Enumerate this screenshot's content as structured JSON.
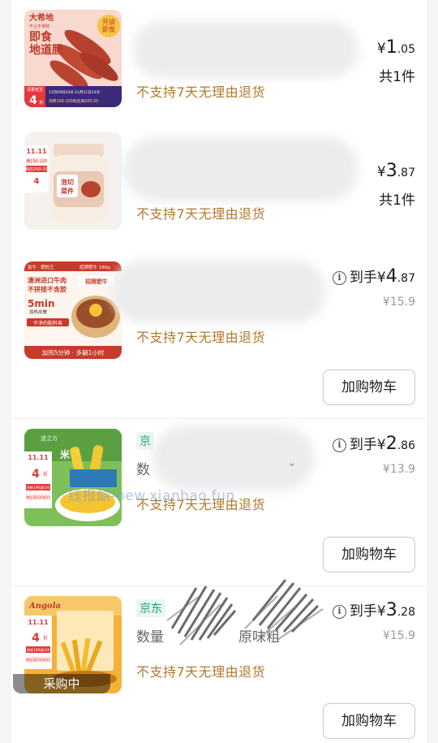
{
  "items": [
    {
      "price_symbol": "¥",
      "price_int": "1",
      "price_dec": ".05",
      "quantity": "共1件",
      "policy": "不支持7天无理由退货",
      "thumb_text": {
        "brand": "大希地",
        "brand_sub": "不止牛排鲜",
        "title_line1": "即食",
        "title_line2": "地道肠",
        "badge_line1": "开袋",
        "badge_line2": "即食",
        "promo_tag": "清香低至",
        "promo_num": "4",
        "promo_unit": "折",
        "date": "11月09日20点-11月11日24点",
        "deal": "领券199-100跨店满200-20"
      }
    },
    {
      "price_symbol": "¥",
      "price_int": "3",
      "price_dec": ".87",
      "quantity": "共1件",
      "policy": "不支持7天无理由退货",
      "thumb_text": {
        "event": "11.11",
        "deal1": "满199-100",
        "deal2": "跨店200-20",
        "promo_num": "4",
        "label_line1": "泡切",
        "label_line2": "菜件"
      }
    },
    {
      "price_prefix": "到手",
      "price_symbol": "¥",
      "price_int": "4",
      "price_dec": ".87",
      "original_price": "¥15.9",
      "policy": "不支持7天无理由退货",
      "cart_label": "加购物车",
      "thumb_text": {
        "header_left": "张牛 · 肥妈王",
        "header_right": "招牌肥牛 180g",
        "line1": "澳洲进口牛肉",
        "line2": "不拼接不含胶",
        "time": "5min",
        "time_sub": "加热出餐",
        "feature": "干净的配料表",
        "bottom": "加热5分钟 · 多躺1小时",
        "label": "招牌肥牛"
      }
    },
    {
      "price_prefix": "到手",
      "price_symbol": "¥",
      "price_int": "2",
      "price_dec": ".86",
      "original_price": "¥13.9",
      "policy": "不支持7天无理由退货",
      "cart_label": "加购物车",
      "tag": "京",
      "meta": "数",
      "thumb_text": {
        "brand": "道之方",
        "event": "11.11",
        "promo_num": "4",
        "unit": "折",
        "deal1": "领券199减100",
        "deal2": "跨店满200减20",
        "word": "米"
      }
    },
    {
      "price_prefix": "到手",
      "price_symbol": "¥",
      "price_int": "3",
      "price_dec": ".28",
      "original_price": "¥15.9",
      "policy": "不支持7天无理由退货",
      "cart_label": "加购物车",
      "tag": "京东",
      "meta": "数量",
      "meta_tail": "原味粗",
      "status": "采购中",
      "thumb_text": {
        "brand": "Angola",
        "event": "11.11",
        "promo_num": "4",
        "unit": "折",
        "deal1": "领券199减100",
        "deal2": "跨店满200减20"
      }
    }
  ],
  "watermark": "线报酷-new.xianbao.fun",
  "colors": {
    "policy": "#b07a2e",
    "accent_red": "#e4393c",
    "tag_green": "#2a9a6a"
  }
}
